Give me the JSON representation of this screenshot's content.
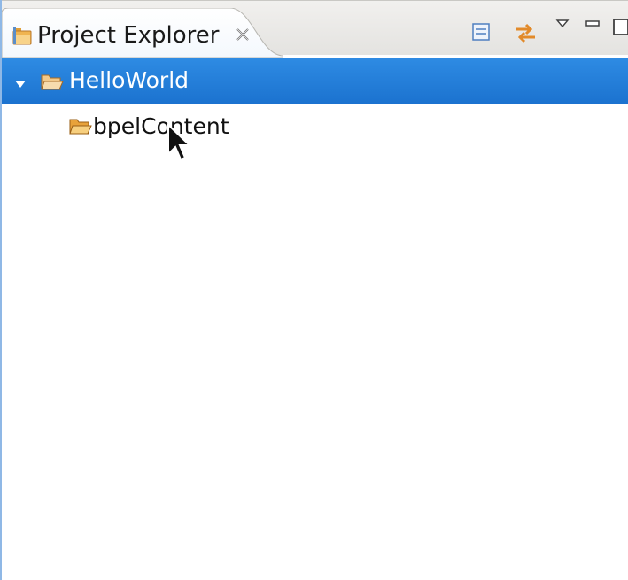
{
  "view": {
    "tab_title": "Project Explorer",
    "toolbar": {
      "collapse_all_icon": "collapse-all-icon",
      "link_with_editor_icon": "link-with-editor-icon",
      "view_menu_icon": "view-menu-icon",
      "minimize_icon": "minimize-icon",
      "maximize_icon": "maximize-icon"
    }
  },
  "tree": {
    "items": [
      {
        "label": "HelloWorld",
        "expanded": true,
        "selected": true,
        "icon": "open-project-folder-icon"
      },
      {
        "label": "bpelContent",
        "expanded": false,
        "selected": false,
        "icon": "open-folder-icon"
      }
    ]
  },
  "colors": {
    "selection": "#1f78d6",
    "folder": "#e8a23a",
    "background": "#ffffff"
  }
}
